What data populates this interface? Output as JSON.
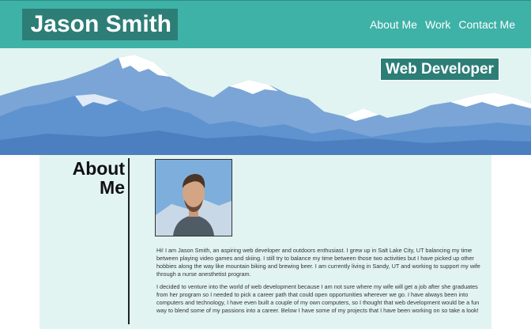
{
  "header": {
    "brand": "Jason Smith",
    "nav": [
      "About Me",
      "Work",
      "Contact Me"
    ]
  },
  "banner": {
    "tagline": "Web Developer"
  },
  "about": {
    "title_line1": "About",
    "title_line2": "Me",
    "paragraphs": [
      "Hi! I am Jason Smith, an aspiring web developer and outdoors enthusiast. I grew up in Salt Lake City, UT balancing my time between playing video games and skiing. I still try to balance my time between those two activities but I have picked up other hobbies along the way like mountain biking and brewing beer. I am currently living in Sandy, UT and working to support my wife through a nurse anesthetist program.",
      "I decided to venture into the world of web development because I am not sure where my wife will get a job after she graduates from her program so I needed to pick a career path that could open opportunities wherever we go. I have always been into computers and technology, I have even built a couple of my own computers, so I thought that web development would be a fun way to blend some of my passions into a career. Below I have some of my projects that I have been working on so take a look!"
    ]
  },
  "colors": {
    "header_bg": "#3fb2a8",
    "brand_bg": "#2c7e77",
    "content_bg": "#e2f4f1",
    "mountain_blue": "#5f93cf"
  }
}
